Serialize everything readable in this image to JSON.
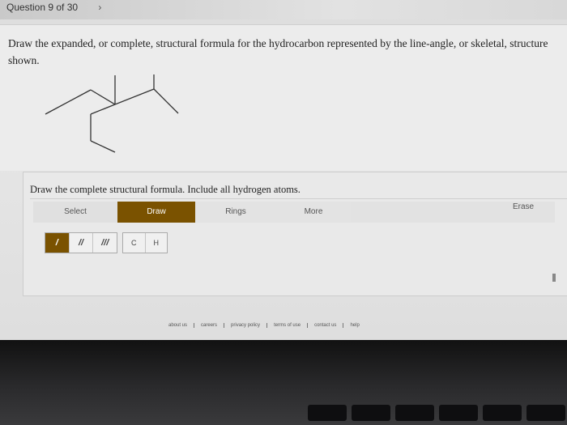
{
  "header": {
    "question_nav": "Question 9 of 30",
    "next_icon": "chevron-right-icon"
  },
  "question": {
    "text": "Draw the expanded, or complete, structural formula for the hydrocarbon represented by the line-angle, or skeletal, structure shown."
  },
  "draw_panel": {
    "instruction": "Draw the complete structural formula. Include all hydrogen atoms.",
    "tabs": {
      "select": "Select",
      "draw": "Draw",
      "rings": "Rings",
      "more": "More",
      "erase": "Erase"
    },
    "bonds": [
      "/",
      "//",
      "///"
    ],
    "atoms": [
      "C",
      "H"
    ]
  },
  "footer": {
    "links": [
      "about us",
      "careers",
      "privacy policy",
      "terms of use",
      "contact us",
      "help"
    ]
  },
  "colors": {
    "accent": "#7a5200"
  }
}
